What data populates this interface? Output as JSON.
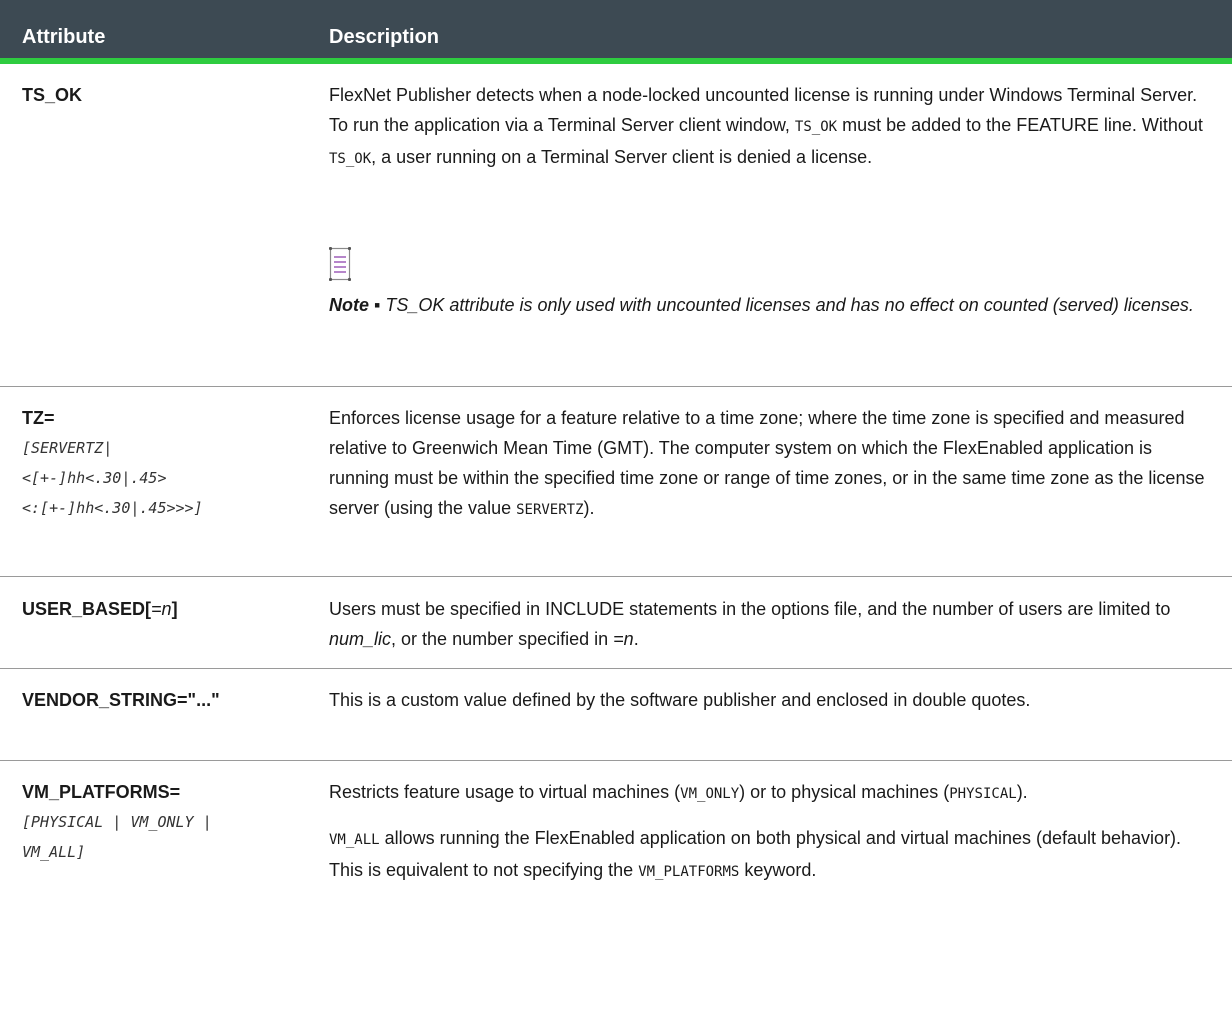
{
  "header": {
    "col1": "Attribute",
    "col2": "Description"
  },
  "rows": {
    "ts_ok": {
      "attr": "TS_OK",
      "desc_a": "FlexNet Publisher detects when a node-locked uncounted license is running under Windows Terminal Server. To run the application via a Terminal Server client window, ",
      "code1": "TS_OK",
      "desc_b": " must be added to the FEATURE line. Without ",
      "code2": "TS_OK",
      "desc_c": ", a user running on a Terminal Server client is denied a license.",
      "note_label": "Note ▪",
      "note_text": " TS_OK attribute is only used with uncounted licenses and has no effect on counted (served) licenses."
    },
    "tz": {
      "attr": "TZ=",
      "syntax1": "[SERVERTZ|",
      "syntax2": "<[+-]hh<.30|.45>",
      "syntax3": "<:[+-]hh<.30|.45>>>]",
      "desc_a": "Enforces license usage for a feature relative to a time zone; where the time zone is specified and measured relative to Greenwich Mean Time (GMT). The computer system on which the FlexEnabled application is running must be within the specified time zone or range of time zones, or in the same time zone as the license server (using the value ",
      "code1": "SERVERTZ",
      "desc_b": ")."
    },
    "user_based": {
      "attr": "USER_BASED[",
      "attr_n": "=n",
      "attr_end": "]",
      "desc_a": "Users must be specified in INCLUDE statements in the options file, and the number of users are limited to ",
      "em1": "num_lic",
      "desc_b": ", or the number specified in ",
      "em2": "=n",
      "desc_c": "."
    },
    "vendor_string": {
      "attr": "VENDOR_STRING=\"...\"",
      "desc": "This is a custom value defined by the software publisher and enclosed in double quotes."
    },
    "vm_platforms": {
      "attr": "VM_PLATFORMS=",
      "syntax1": "[PHYSICAL | VM_ONLY |",
      "syntax2": "VM_ALL]",
      "p1_a": "Restricts feature usage to virtual machines (",
      "p1_code1": "VM_ONLY",
      "p1_b": ") or to physical machines (",
      "p1_code2": "PHYSICAL",
      "p1_c": ").",
      "p2_code1": "VM_ALL",
      "p2_a": " allows running the FlexEnabled application on both physical and virtual machines (default behavior). This is equivalent to not specifying the ",
      "p2_code2": "VM_PLATFORMS",
      "p2_b": " keyword."
    }
  }
}
